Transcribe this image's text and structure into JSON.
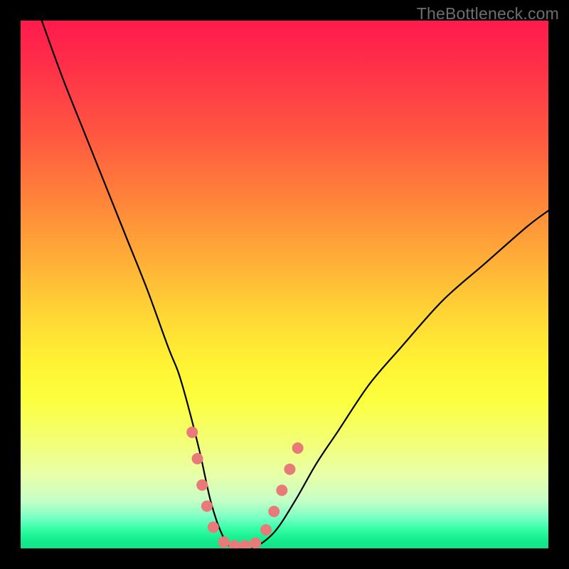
{
  "watermark": "TheBottleneck.com",
  "colors": {
    "background": "#000000",
    "gradient_top": "#ff1a4d",
    "gradient_mid": "#fff334",
    "gradient_bottom": "#12e187",
    "curve": "#000000",
    "marker": "#e87a7a"
  },
  "chart_data": {
    "type": "line",
    "title": "",
    "xlabel": "",
    "ylabel": "",
    "xlim": [
      0,
      100
    ],
    "ylim": [
      0,
      100
    ],
    "series": [
      {
        "name": "bottleneck-curve",
        "x": [
          4,
          8,
          12,
          16,
          20,
          24,
          28,
          30,
          32,
          34,
          36,
          38,
          40,
          42,
          44,
          48,
          52,
          56,
          60,
          66,
          72,
          80,
          88,
          96,
          100
        ],
        "y": [
          100,
          89,
          79,
          69,
          59,
          49,
          38,
          33,
          26,
          18,
          9,
          3,
          0,
          0,
          0,
          3,
          9,
          16,
          22,
          31,
          38,
          47,
          54,
          61,
          64
        ]
      }
    ],
    "markers": [
      {
        "name": "left-cap-top",
        "x": 32.5,
        "y": 22.0
      },
      {
        "name": "left-cap-2",
        "x": 33.5,
        "y": 17.0
      },
      {
        "name": "left-cap-3",
        "x": 34.4,
        "y": 12.0
      },
      {
        "name": "left-cap-4",
        "x": 35.3,
        "y": 8.0
      },
      {
        "name": "left-cap-bottom",
        "x": 36.5,
        "y": 4.0
      },
      {
        "name": "trough-1",
        "x": 38.5,
        "y": 1.2
      },
      {
        "name": "trough-2",
        "x": 40.5,
        "y": 0.5
      },
      {
        "name": "trough-3",
        "x": 42.5,
        "y": 0.5
      },
      {
        "name": "trough-4",
        "x": 44.5,
        "y": 1.0
      },
      {
        "name": "right-cap-bottom",
        "x": 46.5,
        "y": 3.5
      },
      {
        "name": "right-cap-2",
        "x": 48.0,
        "y": 7.0
      },
      {
        "name": "right-cap-3",
        "x": 49.5,
        "y": 11.0
      },
      {
        "name": "right-cap-4",
        "x": 51.0,
        "y": 15.0
      },
      {
        "name": "right-cap-top",
        "x": 52.5,
        "y": 19.0
      }
    ],
    "marker_radius_px": 8
  }
}
